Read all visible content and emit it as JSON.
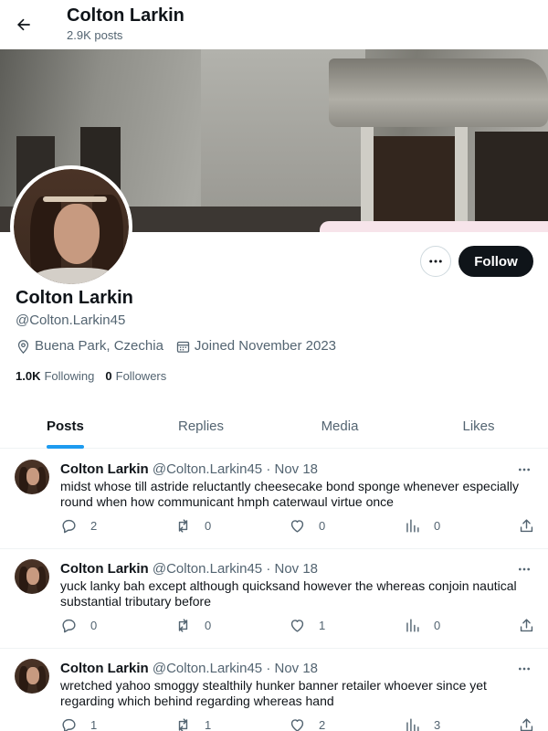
{
  "header": {
    "name": "Colton Larkin",
    "posts_count": "2.9K posts"
  },
  "profile": {
    "name": "Colton Larkin",
    "handle": "@Colton.Larkin45",
    "location": "Buena Park, Czechia",
    "joined": "Joined November 2023",
    "following_count": "1.0K",
    "following_label": "Following",
    "followers_count": "0",
    "followers_label": "Followers",
    "follow_label": "Follow"
  },
  "tabs": [
    {
      "label": "Posts",
      "active": true
    },
    {
      "label": "Replies",
      "active": false
    },
    {
      "label": "Media",
      "active": false
    },
    {
      "label": "Likes",
      "active": false
    }
  ],
  "posts": [
    {
      "name": "Colton Larkin",
      "handle": "@Colton.Larkin45",
      "dot": "·",
      "date": "Nov 18",
      "text": "midst whose till astride reluctantly cheesecake bond sponge whenever especially round when how communicant hmph caterwaul virtue once",
      "replies": "2",
      "reposts": "0",
      "likes": "0",
      "views": "0"
    },
    {
      "name": "Colton Larkin",
      "handle": "@Colton.Larkin45",
      "dot": "·",
      "date": "Nov 18",
      "text": "yuck lanky bah except although quicksand however the whereas conjoin nautical substantial tributary before",
      "replies": "0",
      "reposts": "0",
      "likes": "1",
      "views": "0"
    },
    {
      "name": "Colton Larkin",
      "handle": "@Colton.Larkin45",
      "dot": "·",
      "date": "Nov 18",
      "text": "wretched yahoo smoggy stealthily hunker banner retailer whoever since yet regarding which behind regarding whereas hand",
      "replies": "1",
      "reposts": "1",
      "likes": "2",
      "views": "3"
    }
  ],
  "icons": {
    "back": "arrow-left-icon",
    "more": "more-horizontal-icon",
    "location": "location-pin-icon",
    "calendar": "calendar-icon",
    "reply": "reply-icon",
    "repost": "repost-icon",
    "like": "heart-icon",
    "views": "views-chart-icon",
    "share": "share-icon"
  },
  "colors": {
    "accent": "#1d9bf0",
    "text": "#0f1419",
    "muted": "#536471",
    "follow_bg": "#0f1419"
  }
}
